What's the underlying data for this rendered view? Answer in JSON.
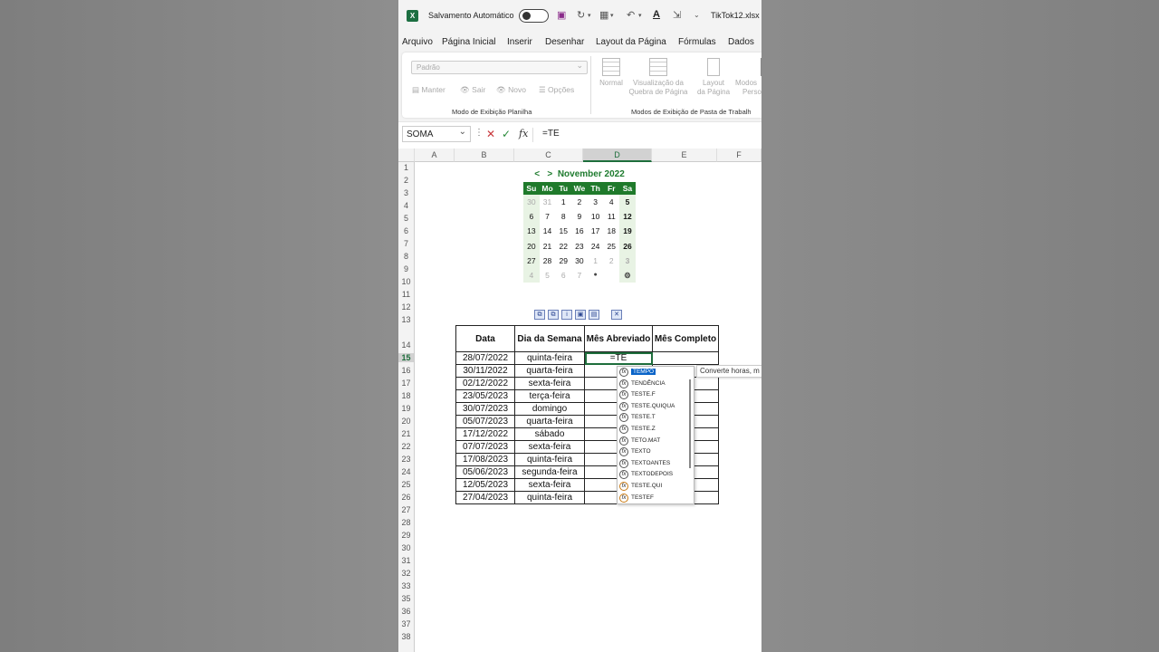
{
  "titlebar": {
    "autosave_label": "Salvamento Automático",
    "filename": "TikTok12.xlsx"
  },
  "menu": [
    "Arquivo",
    "Página Inicial",
    "Inserir",
    "Desenhar",
    "Layout da Página",
    "Fórmulas",
    "Dados"
  ],
  "ribbon": {
    "view_select": "Padrão",
    "sheet_buttons": [
      "Manter",
      "Sair",
      "Novo",
      "Opções"
    ],
    "group1_label": "Modo de Exibição Planilha",
    "group2_label": "Modos de Exibição de Pasta de Trabalh",
    "big_buttons": [
      {
        "line1": "Normal",
        "line2": ""
      },
      {
        "line1": "Visualização da",
        "line2": "Quebra de Página"
      },
      {
        "line1": "Layout",
        "line2": "da Página"
      },
      {
        "line1": "Modos",
        "line2": "Perso"
      }
    ]
  },
  "formula_bar": {
    "name_box": "SOMA",
    "formula": "=TE"
  },
  "columns": [
    "A",
    "B",
    "C",
    "D",
    "E",
    "F"
  ],
  "active_column": "D",
  "rows": [
    "1",
    "2",
    "3",
    "4",
    "5",
    "6",
    "7",
    "8",
    "9",
    "10",
    "11",
    "12",
    "13",
    "14",
    "15",
    "16",
    "17",
    "18",
    "19",
    "20",
    "21",
    "22",
    "23",
    "24",
    "25",
    "26",
    "27",
    "28",
    "29",
    "30",
    "31",
    "32",
    "33",
    "35",
    "36",
    "37",
    "38"
  ],
  "active_row": "15",
  "calendar": {
    "prev": "<",
    "next": ">",
    "month_year": "November 2022",
    "weekdays": [
      "Su",
      "Mo",
      "Tu",
      "We",
      "Th",
      "Fr",
      "Sa"
    ],
    "weeks": [
      [
        "30",
        "31",
        "1",
        "2",
        "3",
        "4",
        "5"
      ],
      [
        "6",
        "7",
        "8",
        "9",
        "10",
        "11",
        "12"
      ],
      [
        "13",
        "14",
        "15",
        "16",
        "17",
        "18",
        "19"
      ],
      [
        "20",
        "21",
        "22",
        "23",
        "24",
        "25",
        "26"
      ],
      [
        "27",
        "28",
        "29",
        "30",
        "1",
        "2",
        "3"
      ],
      [
        "4",
        "5",
        "6",
        "7",
        "",
        "",
        ""
      ]
    ],
    "info_icon": "info-icon",
    "settings_icon": "gear-icon"
  },
  "table": {
    "headers": [
      "Data",
      "Dia da Semana",
      "Mês Abreviado",
      "Mês Completo"
    ],
    "rows": [
      [
        "28/07/2022",
        "quinta-feira",
        "=TE",
        ""
      ],
      [
        "30/11/2022",
        "quarta-feira",
        "",
        ""
      ],
      [
        "02/12/2022",
        "sexta-feira",
        "",
        ""
      ],
      [
        "23/05/2023",
        "terça-feira",
        "",
        ""
      ],
      [
        "30/07/2023",
        "domingo",
        "",
        ""
      ],
      [
        "05/07/2023",
        "quarta-feira",
        "",
        ""
      ],
      [
        "17/12/2022",
        "sábado",
        "",
        ""
      ],
      [
        "07/07/2023",
        "sexta-feira",
        "",
        ""
      ],
      [
        "17/08/2023",
        "quinta-feira",
        "",
        ""
      ],
      [
        "05/06/2023",
        "segunda-feira",
        "",
        ""
      ],
      [
        "12/05/2023",
        "sexta-feira",
        "",
        ""
      ],
      [
        "27/04/2023",
        "quinta-feira",
        "",
        ""
      ]
    ]
  },
  "autocomplete": {
    "items": [
      "TEMPO",
      "TENDÊNCIA",
      "TESTE.F",
      "TESTE.QUIQUA",
      "TESTE.T",
      "TESTE.Z",
      "TETO.MAT",
      "TEXTO",
      "TEXTOANTES",
      "TEXTODEPOIS",
      "TESTE.QUI",
      "TESTEF"
    ],
    "selected_index": 0,
    "tooltip": "Converte horas, m"
  },
  "colors": {
    "excel_green": "#1d6f42",
    "calendar_green": "#1f7a2b",
    "selection_blue": "#0a64c8"
  }
}
